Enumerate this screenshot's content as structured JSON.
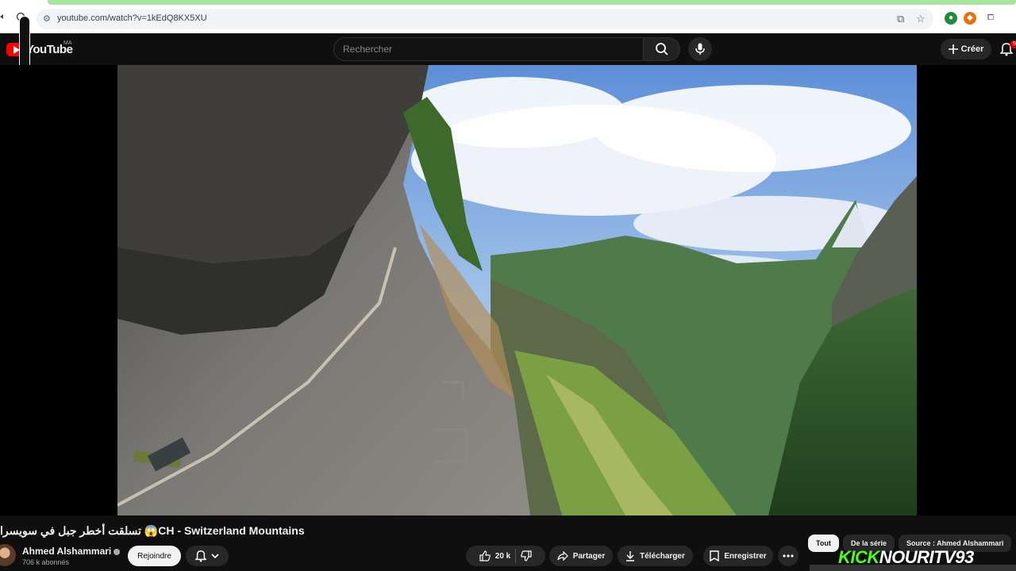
{
  "browser": {
    "url": "youtube.com/watch?v=1kEdQ8KX5XU"
  },
  "header": {
    "logo_text": "YouTube",
    "region": "MA",
    "search_placeholder": "Rechercher",
    "create_label": "Créer",
    "notif_count": "9"
  },
  "video": {
    "title": "تسلقت أخطر جبل في سويسرا 😱CH - Switzerland Mountains"
  },
  "channel": {
    "name": "Ahmed Alshammari",
    "subscribers": "706 k abonnés",
    "join_label": "Rejoindre"
  },
  "actions": {
    "likes": "20 k",
    "share": "Partager",
    "download": "Télécharger",
    "save": "Enregistrer"
  },
  "chips": [
    "Tout",
    "De la série",
    "Source : Ahmed Alshammari"
  ],
  "watermark": {
    "kick": "KICK",
    "name": "NOURITV93"
  },
  "colors": {
    "brand_red": "#ff0000",
    "kick_green": "#53fc18"
  }
}
